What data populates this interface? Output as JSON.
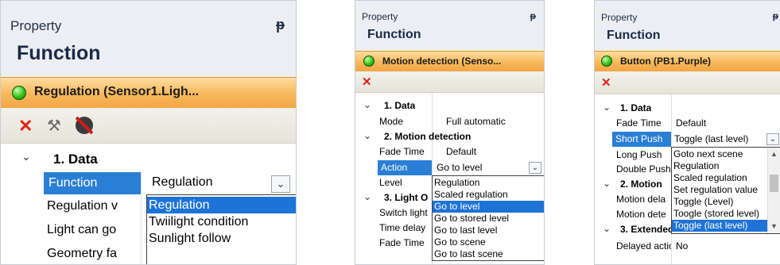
{
  "panel1": {
    "title": "Property",
    "pin": "ᵽ",
    "function": "Function",
    "selected": "Regulation (Sensor1.Ligh...",
    "rows": [
      {
        "label": "1. Data"
      },
      {
        "label": "Function",
        "value": "Regulation"
      },
      {
        "label": "Regulation v"
      },
      {
        "label": "Light can go"
      },
      {
        "label": "Geometry fa"
      }
    ],
    "dropdown": [
      "Regulation",
      "Twiilight condition",
      "Sunlight follow"
    ],
    "selected_option": "Regulation"
  },
  "panel2": {
    "title": "Property",
    "pin": "ᵽ",
    "function": "Function",
    "selected": "Motion detection (Senso...",
    "rows": [
      {
        "label": "1. Data"
      },
      {
        "label": "Mode",
        "value": "Full automatic"
      },
      {
        "label": "2. Motion detection"
      },
      {
        "label": "Fade Time",
        "value": "Default"
      },
      {
        "label": "Action",
        "value": "Go to level"
      },
      {
        "label": "Level"
      },
      {
        "label": "3. Light O"
      },
      {
        "label": "Switch light"
      },
      {
        "label": "Time delay"
      },
      {
        "label": "Fade Time"
      }
    ],
    "dropdown": [
      "Regulation",
      "Scaled regulation",
      "Go to level",
      "Go to stored level",
      "Go to last level",
      "Go to scene",
      "Go to last scene"
    ],
    "selected_option": "Go to level"
  },
  "panel3": {
    "title": "Property",
    "pin": "ᵽ",
    "function": "Function",
    "selected": "Button (PB1.Purple)",
    "rows": [
      {
        "label": "1. Data"
      },
      {
        "label": "Fade Time",
        "value": "Default"
      },
      {
        "label": "Short Push",
        "value": "Toggle (last level)"
      },
      {
        "label": "Long Push"
      },
      {
        "label": "Double Push"
      },
      {
        "label": "2. Motion"
      },
      {
        "label": "Motion dela"
      },
      {
        "label": "Motion dete"
      },
      {
        "label": "3. Extended"
      },
      {
        "label": "Delayed actior",
        "value": "No"
      }
    ],
    "dropdown": [
      "Goto next scene",
      "Regulation",
      "Scaled regulation",
      "Set regulation value",
      "Toggle (Level)",
      "Toogle (stored level)",
      "Toggle (last level)"
    ],
    "selected_option": "Toggle (last level)"
  },
  "icons": {
    "expand": "chevron-down-icon",
    "delete": "red-x-icon",
    "tools": "tools-icon",
    "disable": "globe-disable-icon",
    "scroll_up": "caret-up",
    "scroll_down": "caret-down"
  },
  "colors": {
    "selection_orange": "#f7b85a",
    "highlight_blue": "#1e73d6",
    "delete_red": "#e0211a",
    "status_green": "#35c21c"
  }
}
